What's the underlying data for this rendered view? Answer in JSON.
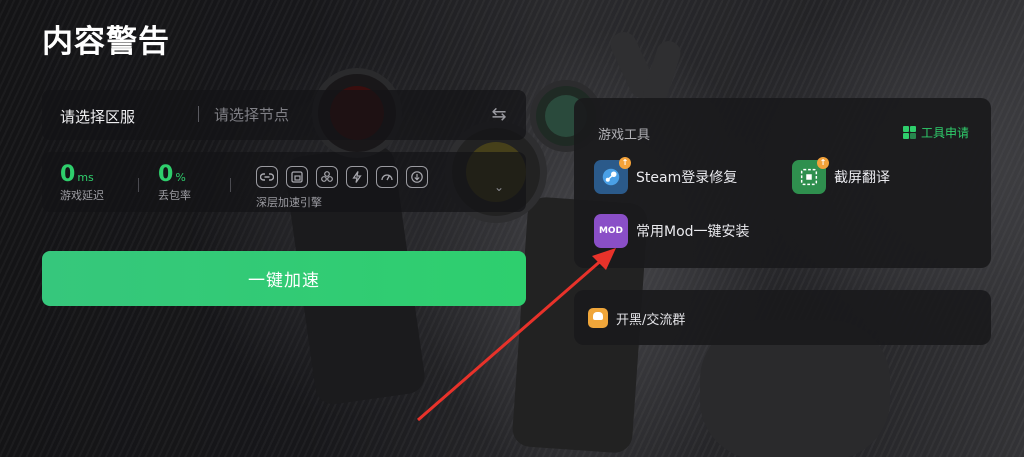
{
  "page": {
    "title": "内容警告"
  },
  "region": {
    "label": "请选择区服",
    "node_placeholder": "请选择节点"
  },
  "stats": {
    "latency": {
      "value": "0",
      "unit": "ms",
      "label": "游戏延迟"
    },
    "packet_loss": {
      "value": "0",
      "unit": "%",
      "label": "丢包率"
    },
    "engine_label": "深层加速引擎",
    "engine_icons": [
      "link-icon",
      "window-icon",
      "share-icon",
      "lightning-icon",
      "speed-icon",
      "download-icon"
    ]
  },
  "accelerate_button": "一键加速",
  "tools": {
    "title": "游戏工具",
    "apply_label": "工具申请",
    "items": [
      {
        "label": "Steam登录修复",
        "icon": "steam-icon"
      },
      {
        "label": "截屏翻译",
        "icon": "screenshot-translate-icon"
      },
      {
        "label": "常用Mod一键安装",
        "icon": "mod-install-icon",
        "icon_text": "MOD"
      }
    ]
  },
  "community": {
    "label": "开黑/交流群"
  },
  "colors": {
    "accent_green": "#2fce6c",
    "annotation_arrow": "#e8322a",
    "badge_orange": "#f3a23a"
  }
}
